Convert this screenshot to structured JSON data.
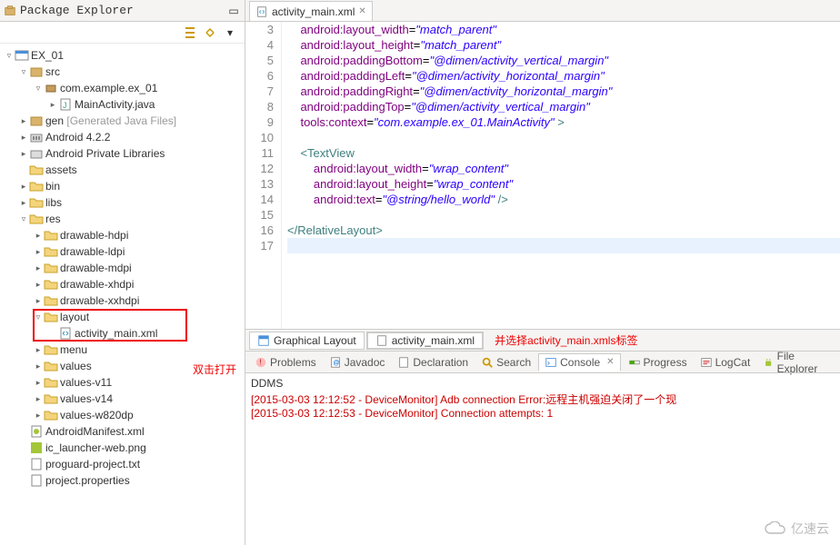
{
  "sidebar": {
    "title": "Package Explorer",
    "project": "EX_01",
    "src": "src",
    "pkg": "com.example.ex_01",
    "mainActivity": "MainActivity.java",
    "gen": "gen",
    "genNote": "[Generated Java Files]",
    "android": "Android 4.2.2",
    "privLib": "Android Private Libraries",
    "assets": "assets",
    "bin": "bin",
    "libs": "libs",
    "res": "res",
    "drawables": [
      "drawable-hdpi",
      "drawable-ldpi",
      "drawable-mdpi",
      "drawable-xhdpi",
      "drawable-xxhdpi"
    ],
    "layout": "layout",
    "activityMainXml": "activity_main.xml",
    "menu": "menu",
    "values": "values",
    "valuesDirs": [
      "values-v11",
      "values-v14",
      "values-w820dp"
    ],
    "manifest": "AndroidManifest.xml",
    "launcher": "ic_launcher-web.png",
    "proguard": "proguard-project.txt",
    "projectProps": "project.properties"
  },
  "annotations": {
    "doubleClick": "双击打开",
    "selectTab": "并选择activity_main.xmls标签"
  },
  "editor": {
    "tabTitle": "activity_main.xml",
    "lines": [
      3,
      4,
      5,
      6,
      7,
      8,
      9,
      10,
      11,
      12,
      13,
      14,
      15,
      16,
      17
    ],
    "code": {
      "l3a": "android:layout_width",
      "l3b": "\"match_parent\"",
      "l4a": "android:layout_height",
      "l4b": "\"match_parent\"",
      "l5a": "android:paddingBottom",
      "l5b": "\"@dimen/activity_vertical_margin\"",
      "l6a": "android:paddingLeft",
      "l6b": "\"@dimen/activity_horizontal_margin\"",
      "l7a": "android:paddingRight",
      "l7b": "\"@dimen/activity_horizontal_margin\"",
      "l8a": "android:paddingTop",
      "l8b": "\"@dimen/activity_vertical_margin\"",
      "l9a": "tools:context",
      "l9b": "\"com.example.ex_01.MainActivity\"",
      "l9c": " >",
      "l11": "<TextView",
      "l12a": "android:layout_width",
      "l12b": "\"wrap_content\"",
      "l13a": "android:layout_height",
      "l13b": "\"wrap_content\"",
      "l14a": "android:text",
      "l14b": "\"@string/hello_world\"",
      "l14c": " />",
      "l16": "</RelativeLayout>"
    },
    "bottomTabs": {
      "graphical": "Graphical Layout",
      "xml": "activity_main.xml"
    }
  },
  "views": {
    "problems": "Problems",
    "javadoc": "Javadoc",
    "declaration": "Declaration",
    "search": "Search",
    "console": "Console",
    "progress": "Progress",
    "logcat": "LogCat",
    "fileExplorer": "File Explorer"
  },
  "console": {
    "title": "DDMS",
    "line1": "[2015-03-03 12:12:52 - DeviceMonitor] Adb connection Error:远程主机强迫关闭了一个现",
    "line2": "[2015-03-03 12:12:53 - DeviceMonitor] Connection attempts: 1"
  },
  "watermark": "亿速云"
}
